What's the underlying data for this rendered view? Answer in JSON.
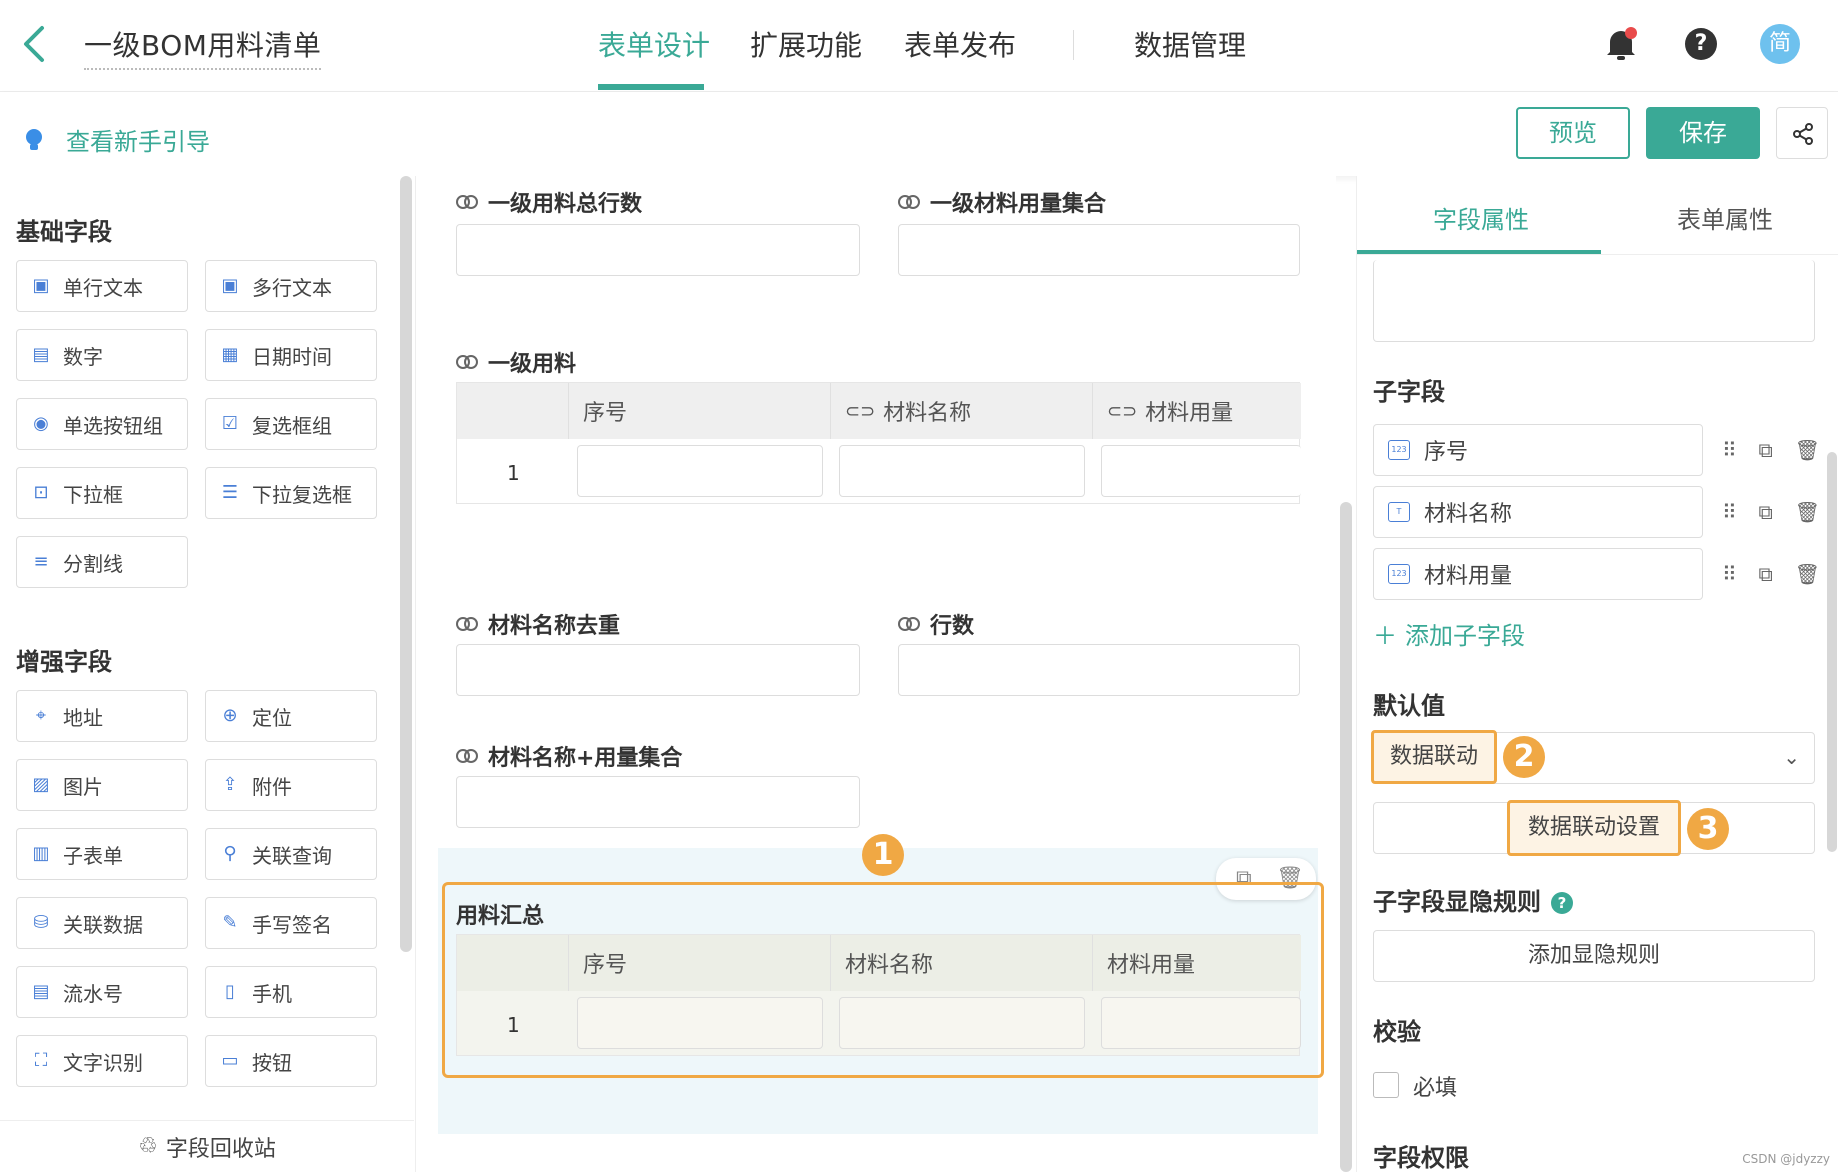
{
  "header": {
    "app_title": "一级BOM用料清单",
    "tabs": [
      {
        "label": "表单设计",
        "active": true
      },
      {
        "label": "扩展功能",
        "active": false
      },
      {
        "label": "表单发布",
        "active": false
      },
      {
        "label": "数据管理",
        "active": false
      }
    ],
    "help_glyph": "?",
    "avatar_text": "简"
  },
  "subbar": {
    "guide_label": "查看新手引导",
    "preview_label": "预览",
    "save_label": "保存"
  },
  "left_panel": {
    "basic_title": "基础字段",
    "basic_fields": [
      {
        "label": "单行文本",
        "icon": "single-line-text-icon"
      },
      {
        "label": "多行文本",
        "icon": "multi-line-text-icon"
      },
      {
        "label": "数字",
        "icon": "number-icon"
      },
      {
        "label": "日期时间",
        "icon": "calendar-icon"
      },
      {
        "label": "单选按钮组",
        "icon": "radio-icon"
      },
      {
        "label": "复选框组",
        "icon": "checkbox-group-icon"
      },
      {
        "label": "下拉框",
        "icon": "dropdown-icon"
      },
      {
        "label": "下拉复选框",
        "icon": "dropdown-multi-icon"
      },
      {
        "label": "分割线",
        "icon": "divider-icon"
      }
    ],
    "enhanced_title": "增强字段",
    "enhanced_fields": [
      {
        "label": "地址",
        "icon": "address-icon"
      },
      {
        "label": "定位",
        "icon": "location-icon"
      },
      {
        "label": "图片",
        "icon": "image-icon"
      },
      {
        "label": "附件",
        "icon": "attachment-icon"
      },
      {
        "label": "子表单",
        "icon": "subform-icon"
      },
      {
        "label": "关联查询",
        "icon": "linked-query-icon"
      },
      {
        "label": "关联数据",
        "icon": "linked-data-icon"
      },
      {
        "label": "手写签名",
        "icon": "signature-icon"
      },
      {
        "label": "流水号",
        "icon": "serial-number-icon"
      },
      {
        "label": "手机",
        "icon": "phone-icon"
      },
      {
        "label": "文字识别",
        "icon": "ocr-icon"
      },
      {
        "label": "按钮",
        "icon": "button-icon"
      }
    ],
    "recycle_label": "字段回收站"
  },
  "canvas": {
    "field_total_rows": "一级用料总行数",
    "field_material_qty_set": "一级材料用量集合",
    "field_level1_material": "一级用料",
    "table1": {
      "columns": [
        "序号",
        "材料名称",
        "材料用量"
      ],
      "row_index": "1"
    },
    "field_material_name_dedup": "材料名称去重",
    "field_row_count": "行数",
    "field_name_qty_set": "材料名称+用量集合",
    "summary_title": "用料汇总",
    "table2": {
      "columns": [
        "序号",
        "材料名称",
        "材料用量"
      ],
      "row_index": "1"
    },
    "badge1": "1"
  },
  "right_panel": {
    "tab_field_props": "字段属性",
    "tab_form_props": "表单属性",
    "subfields_title": "子字段",
    "subfields": [
      "序号",
      "材料名称",
      "材料用量"
    ],
    "add_subfield": "添加子字段",
    "default_title": "默认值",
    "default_select_value": "数据联动",
    "badge2": "2",
    "linkage_settings_button": "数据联动设置",
    "badge3": "3",
    "visibility_title": "子字段显隐规则",
    "add_visibility_button": "添加显隐规则",
    "validation_title": "校验",
    "required_label": "必填",
    "permission_title": "字段权限"
  },
  "watermark": "CSDN @jdyzzy",
  "colors": {
    "accent": "#3aa996",
    "highlight": "#f0a844",
    "icon_blue": "#4a7fd6"
  }
}
